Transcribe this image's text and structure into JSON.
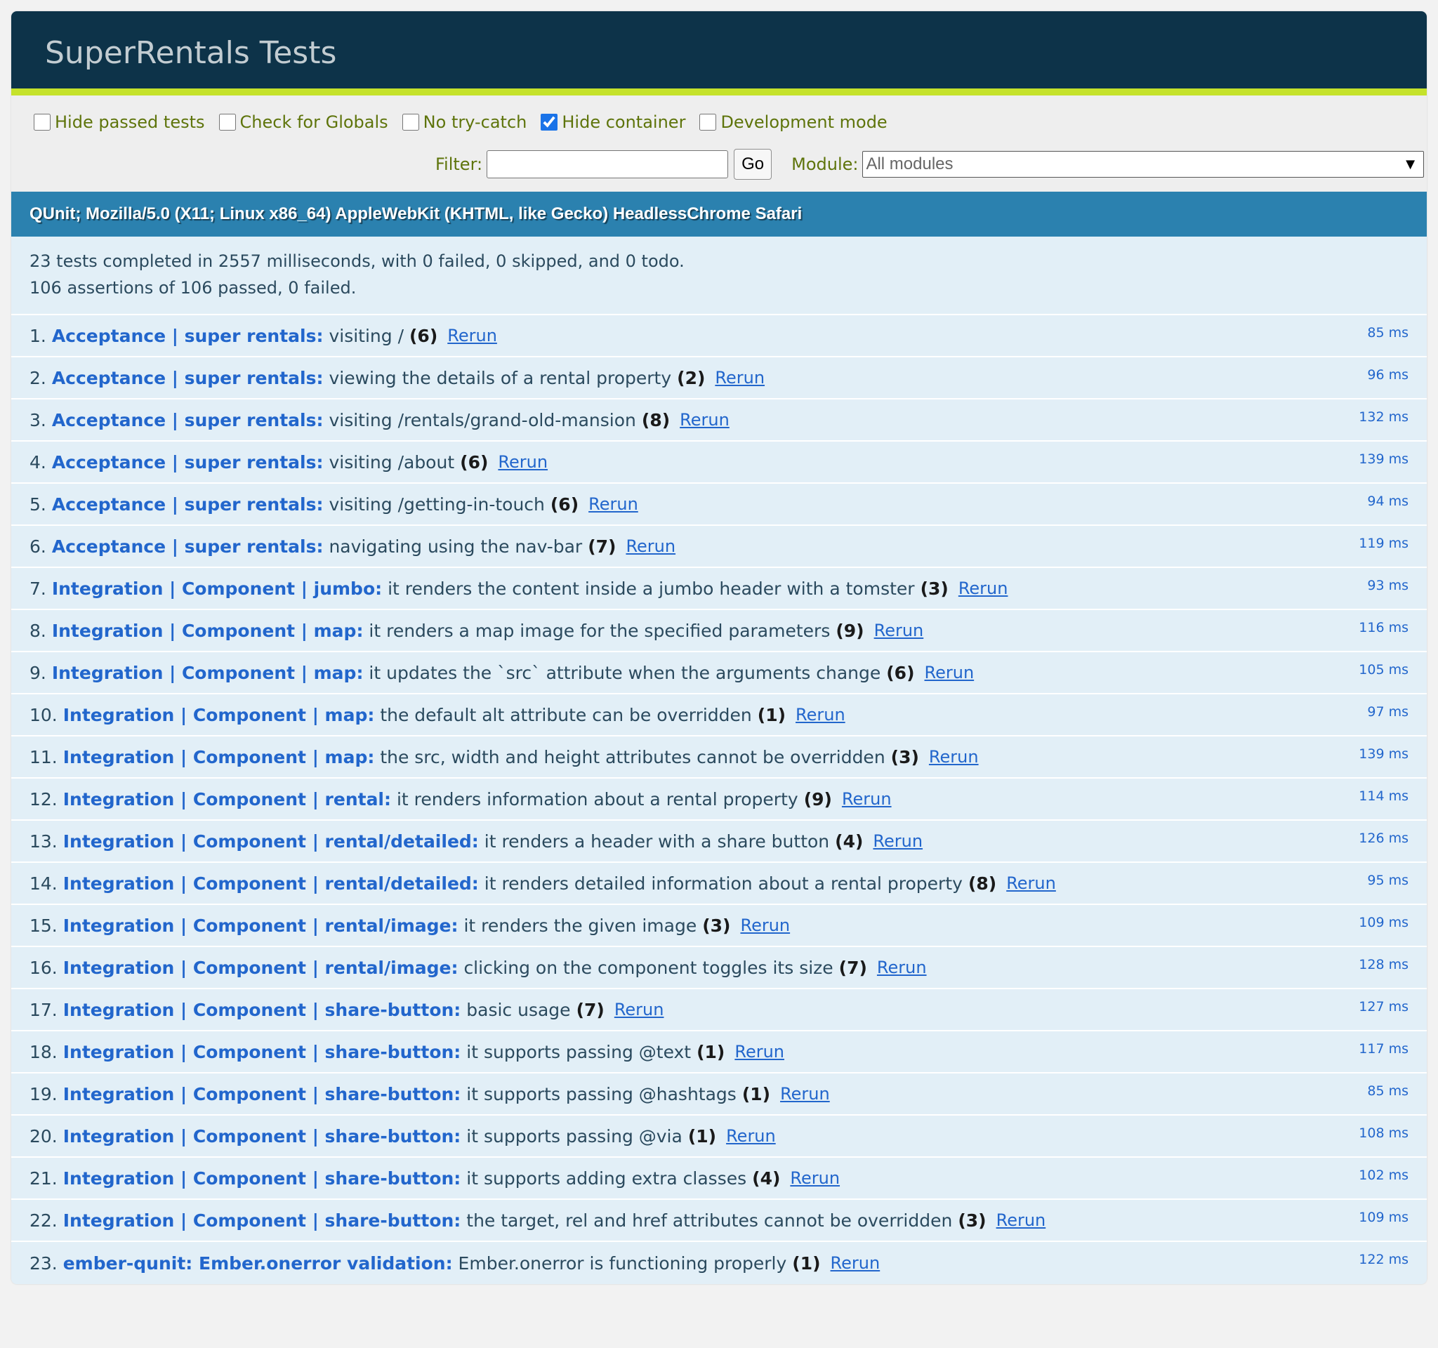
{
  "header": {
    "title": "SuperRentals Tests"
  },
  "toolbar": {
    "options": [
      {
        "label": "Hide passed tests",
        "checked": false
      },
      {
        "label": "Check for Globals",
        "checked": false
      },
      {
        "label": "No try-catch",
        "checked": false
      },
      {
        "label": "Hide container",
        "checked": true
      },
      {
        "label": "Development mode",
        "checked": false
      }
    ],
    "filter_label": "Filter:",
    "filter_value": "",
    "go_label": "Go",
    "module_label": "Module:",
    "module_value": "All modules",
    "dropdown_arrow": "▼"
  },
  "user_agent": "QUnit; Mozilla/5.0 (X11; Linux x86_64) AppleWebKit (KHTML, like Gecko) HeadlessChrome Safari",
  "result": {
    "line1": "23 tests completed in 2557 milliseconds, with 0 failed, 0 skipped, and 0 todo.",
    "line2": "106 assertions of 106 passed, 0 failed."
  },
  "rerun_label": "Rerun",
  "tests": [
    {
      "num": "1.",
      "module": "Acceptance | super rentals:",
      "name": "visiting /",
      "count": "(6)",
      "runtime": "85 ms"
    },
    {
      "num": "2.",
      "module": "Acceptance | super rentals:",
      "name": "viewing the details of a rental property",
      "count": "(2)",
      "runtime": "96 ms"
    },
    {
      "num": "3.",
      "module": "Acceptance | super rentals:",
      "name": "visiting /rentals/grand-old-mansion",
      "count": "(8)",
      "runtime": "132 ms"
    },
    {
      "num": "4.",
      "module": "Acceptance | super rentals:",
      "name": "visiting /about",
      "count": "(6)",
      "runtime": "139 ms"
    },
    {
      "num": "5.",
      "module": "Acceptance | super rentals:",
      "name": "visiting /getting-in-touch",
      "count": "(6)",
      "runtime": "94 ms"
    },
    {
      "num": "6.",
      "module": "Acceptance | super rentals:",
      "name": "navigating using the nav-bar",
      "count": "(7)",
      "runtime": "119 ms"
    },
    {
      "num": "7.",
      "module": "Integration | Component | jumbo:",
      "name": "it renders the content inside a jumbo header with a tomster",
      "count": "(3)",
      "runtime": "93 ms"
    },
    {
      "num": "8.",
      "module": "Integration | Component | map:",
      "name": "it renders a map image for the specified parameters",
      "count": "(9)",
      "runtime": "116 ms"
    },
    {
      "num": "9.",
      "module": "Integration | Component | map:",
      "name": "it updates the `src` attribute when the arguments change",
      "count": "(6)",
      "runtime": "105 ms"
    },
    {
      "num": "10.",
      "module": "Integration | Component | map:",
      "name": "the default alt attribute can be overridden",
      "count": "(1)",
      "runtime": "97 ms"
    },
    {
      "num": "11.",
      "module": "Integration | Component | map:",
      "name": "the src, width and height attributes cannot be overridden",
      "count": "(3)",
      "runtime": "139 ms"
    },
    {
      "num": "12.",
      "module": "Integration | Component | rental:",
      "name": "it renders information about a rental property",
      "count": "(9)",
      "runtime": "114 ms"
    },
    {
      "num": "13.",
      "module": "Integration | Component | rental/detailed:",
      "name": "it renders a header with a share button",
      "count": "(4)",
      "runtime": "126 ms"
    },
    {
      "num": "14.",
      "module": "Integration | Component | rental/detailed:",
      "name": "it renders detailed information about a rental property",
      "count": "(8)",
      "runtime": "95 ms"
    },
    {
      "num": "15.",
      "module": "Integration | Component | rental/image:",
      "name": "it renders the given image",
      "count": "(3)",
      "runtime": "109 ms"
    },
    {
      "num": "16.",
      "module": "Integration | Component | rental/image:",
      "name": "clicking on the component toggles its size",
      "count": "(7)",
      "runtime": "128 ms"
    },
    {
      "num": "17.",
      "module": "Integration | Component | share-button:",
      "name": "basic usage",
      "count": "(7)",
      "runtime": "127 ms"
    },
    {
      "num": "18.",
      "module": "Integration | Component | share-button:",
      "name": "it supports passing @text",
      "count": "(1)",
      "runtime": "117 ms"
    },
    {
      "num": "19.",
      "module": "Integration | Component | share-button:",
      "name": "it supports passing @hashtags",
      "count": "(1)",
      "runtime": "85 ms"
    },
    {
      "num": "20.",
      "module": "Integration | Component | share-button:",
      "name": "it supports passing @via",
      "count": "(1)",
      "runtime": "108 ms"
    },
    {
      "num": "21.",
      "module": "Integration | Component | share-button:",
      "name": "it supports adding extra classes",
      "count": "(4)",
      "runtime": "102 ms"
    },
    {
      "num": "22.",
      "module": "Integration | Component | share-button:",
      "name": "the target, rel and href attributes cannot be overridden",
      "count": "(3)",
      "runtime": "109 ms"
    },
    {
      "num": "23.",
      "module": "ember-qunit: Ember.onerror validation:",
      "name": "Ember.onerror is functioning properly",
      "count": "(1)",
      "runtime": "122 ms"
    }
  ]
}
